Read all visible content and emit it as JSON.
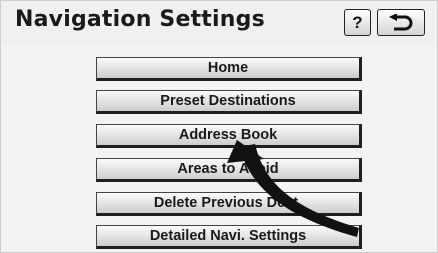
{
  "header": {
    "title": "Navigation Settings",
    "help_label": "?",
    "back_icon": "return-arrow-icon"
  },
  "menu": {
    "items": [
      {
        "label": "Home"
      },
      {
        "label": "Preset Destinations"
      },
      {
        "label": "Address Book"
      },
      {
        "label": "Areas to Avoid"
      },
      {
        "label": "Delete Previous Dest."
      },
      {
        "label": "Detailed Navi. Settings"
      }
    ]
  },
  "annotation": {
    "icon": "curved-arrow-icon",
    "color": "#111111"
  }
}
